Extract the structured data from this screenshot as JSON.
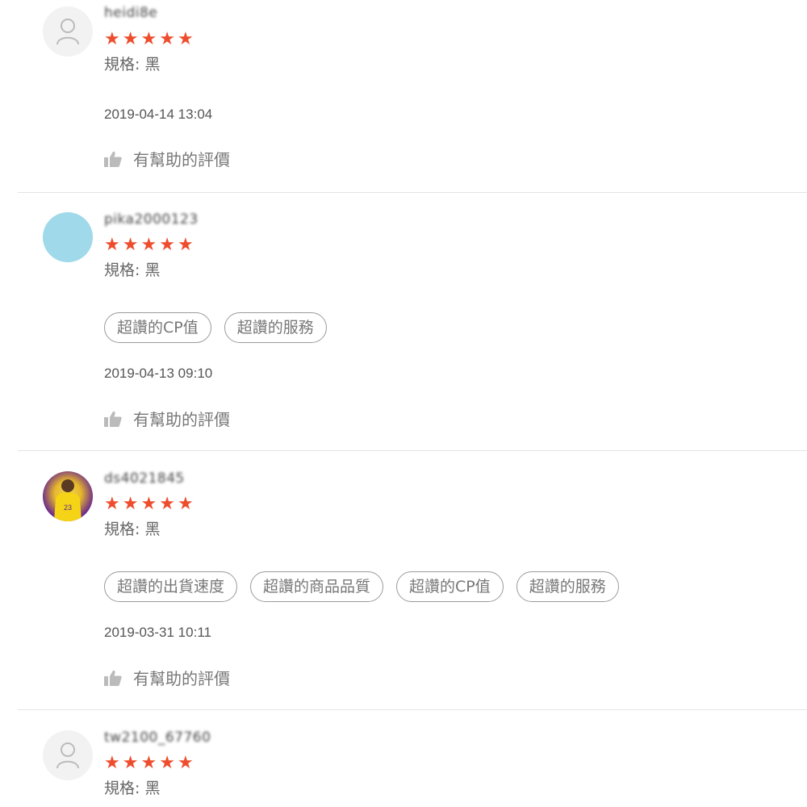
{
  "star_color": "#ee4d2d",
  "helpful_label": "有幫助的評價",
  "reviews": [
    {
      "username": "heidi8e",
      "avatar": "default-user-icon",
      "stars": 5,
      "variation": "規格: 黑",
      "tags": [],
      "date": "2019-04-14 13:04"
    },
    {
      "username": "pika2000123",
      "avatar": "blue-circle",
      "stars": 5,
      "variation": "規格: 黑",
      "tags": [
        "超讚的CP值",
        "超讚的服務"
      ],
      "date": "2019-04-13 09:10"
    },
    {
      "username": "ds4021845",
      "avatar": "photo",
      "stars": 5,
      "variation": "規格: 黑",
      "tags": [
        "超讚的出貨速度",
        "超讚的商品品質",
        "超讚的CP值",
        "超讚的服務"
      ],
      "date": "2019-03-31 10:11"
    },
    {
      "username": "tw2100_67760",
      "avatar": "default-user-icon",
      "stars": 5,
      "variation": "規格: 黑"
    }
  ]
}
